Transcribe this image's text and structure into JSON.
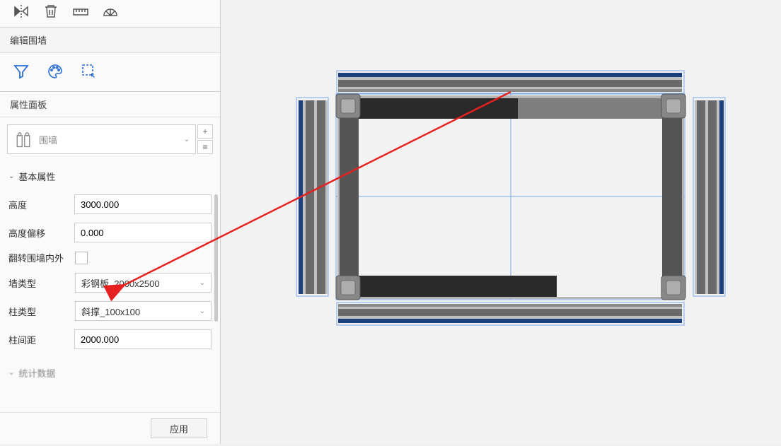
{
  "sections": {
    "edit_wall": "编辑围墙",
    "prop_panel": "属性面板",
    "basic_props": "基本属性",
    "stats": "统计数据"
  },
  "type_selector": {
    "label": "围墙"
  },
  "props": {
    "height_label": "高度",
    "height_value": "3000.000",
    "height_offset_label": "高度偏移",
    "height_offset_value": "0.000",
    "flip_label": "翻转围墙内外",
    "wall_type_label": "墙类型",
    "wall_type_value": "彩钢板_2000x2500",
    "col_type_label": "柱类型",
    "col_type_value": "斜撑_100x100",
    "col_spacing_label": "柱间距",
    "col_spacing_value": "2000.000"
  },
  "buttons": {
    "apply": "应用",
    "plus": "+",
    "equal": "≡"
  }
}
